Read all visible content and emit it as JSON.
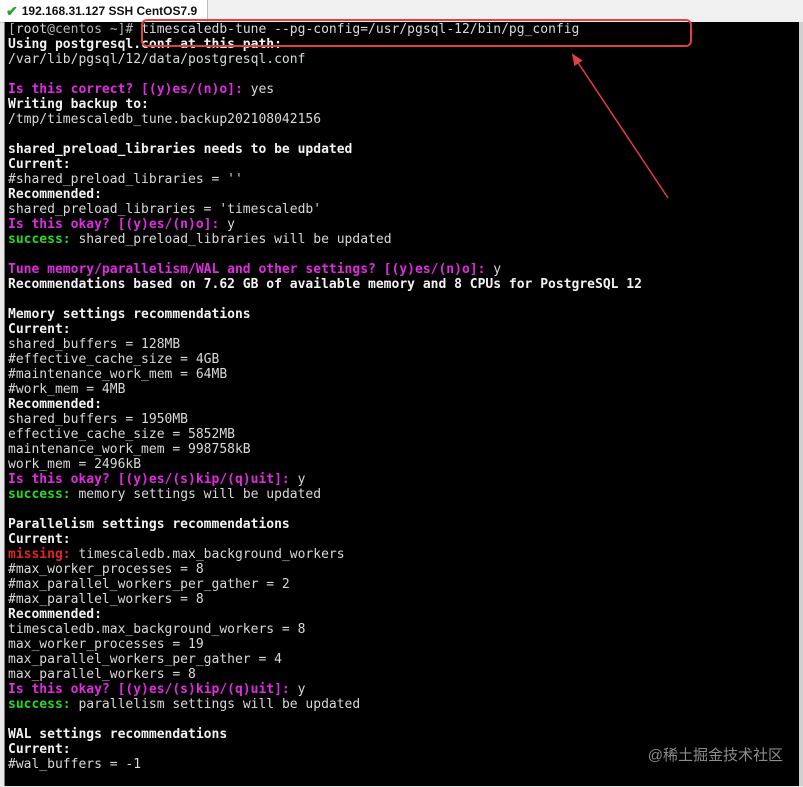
{
  "tab": {
    "title": "192.168.31.127 SSH CentOS7.9"
  },
  "terminal": {
    "lines": [
      [
        [
          "gr",
          "["
        ],
        [
          "",
          "root"
        ],
        [
          "gr",
          "@centos"
        ],
        [
          "gr",
          " ~]# "
        ],
        [
          "",
          "timescaledb-tune --pg-config=/usr/pgsql-12/bin/pg_config"
        ]
      ],
      [
        [
          "b",
          "Using postgresql.conf at this path:"
        ]
      ],
      [
        [
          "",
          "/var/lib/pgsql/12/data/postgresql.conf"
        ]
      ],
      [],
      [
        [
          "m",
          "Is this correct? [(y)es/(n)o]: "
        ],
        [
          "",
          "yes"
        ]
      ],
      [
        [
          "b",
          "Writing backup to:"
        ]
      ],
      [
        [
          "",
          "/tmp/timescaledb_tune.backup202108042156"
        ]
      ],
      [],
      [
        [
          "b",
          "shared_preload_libraries needs to be updated"
        ]
      ],
      [
        [
          "b",
          "Current:"
        ]
      ],
      [
        [
          "",
          "#shared_preload_libraries = ''"
        ]
      ],
      [
        [
          "b",
          "Recommended:"
        ]
      ],
      [
        [
          "",
          "shared_preload_libraries = 'timescaledb'"
        ]
      ],
      [
        [
          "m",
          "Is this okay? [(y)es/(n)o]: "
        ],
        [
          "",
          "y"
        ]
      ],
      [
        [
          "g",
          "success: "
        ],
        [
          "",
          "shared_preload_libraries will be updated"
        ]
      ],
      [],
      [
        [
          "m",
          "Tune memory/parallelism/WAL and other settings? [(y)es/(n)o]: "
        ],
        [
          "",
          "y"
        ]
      ],
      [
        [
          "b",
          "Recommendations based on 7.62 GB of available memory and 8 CPUs for PostgreSQL 12"
        ]
      ],
      [],
      [
        [
          "b",
          "Memory settings recommendations"
        ]
      ],
      [
        [
          "b",
          "Current:"
        ]
      ],
      [
        [
          "",
          "shared_buffers = 128MB"
        ]
      ],
      [
        [
          "",
          "#effective_cache_size = 4GB"
        ]
      ],
      [
        [
          "",
          "#maintenance_work_mem = 64MB"
        ]
      ],
      [
        [
          "",
          "#work_mem = 4MB"
        ]
      ],
      [
        [
          "b",
          "Recommended:"
        ]
      ],
      [
        [
          "",
          "shared_buffers = 1950MB"
        ]
      ],
      [
        [
          "",
          "effective_cache_size = 5852MB"
        ]
      ],
      [
        [
          "",
          "maintenance_work_mem = 998758kB"
        ]
      ],
      [
        [
          "",
          "work_mem = 2496kB"
        ]
      ],
      [
        [
          "m",
          "Is this okay? [(y)es/(s)kip/(q)uit]: "
        ],
        [
          "",
          "y"
        ]
      ],
      [
        [
          "g",
          "success: "
        ],
        [
          "",
          "memory settings will be updated"
        ]
      ],
      [],
      [
        [
          "b",
          "Parallelism settings recommendations"
        ]
      ],
      [
        [
          "b",
          "Current:"
        ]
      ],
      [
        [
          "r",
          "missing: "
        ],
        [
          "",
          "timescaledb.max_background_workers"
        ]
      ],
      [
        [
          "",
          "#max_worker_processes = 8"
        ]
      ],
      [
        [
          "",
          "#max_parallel_workers_per_gather = 2"
        ]
      ],
      [
        [
          "",
          "#max_parallel_workers = 8"
        ]
      ],
      [
        [
          "b",
          "Recommended:"
        ]
      ],
      [
        [
          "",
          "timescaledb.max_background_workers = 8"
        ]
      ],
      [
        [
          "",
          "max_worker_processes = 19"
        ]
      ],
      [
        [
          "",
          "max_parallel_workers_per_gather = 4"
        ]
      ],
      [
        [
          "",
          "max_parallel_workers = 8"
        ]
      ],
      [
        [
          "m",
          "Is this okay? [(y)es/(s)kip/(q)uit]: "
        ],
        [
          "",
          "y"
        ]
      ],
      [
        [
          "g",
          "success: "
        ],
        [
          "",
          "parallelism settings will be updated"
        ]
      ],
      [],
      [
        [
          "b",
          "WAL settings recommendations"
        ]
      ],
      [
        [
          "b",
          "Current:"
        ]
      ],
      [
        [
          "",
          "#wal_buffers = -1"
        ]
      ]
    ]
  },
  "watermark": "@稀土掘金技术社区",
  "colors": {
    "highlight": "#e0403f",
    "prompt": "#e12be1",
    "success": "#26d926",
    "missing": "#e22424"
  }
}
